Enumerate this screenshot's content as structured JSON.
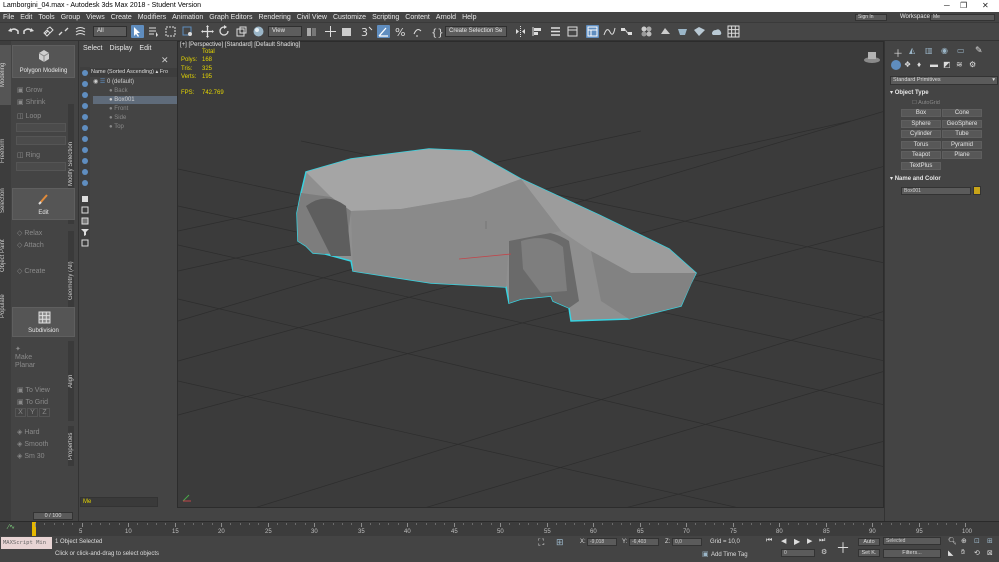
{
  "app": {
    "window_title": "Lamborgini_04.max - Autodesk 3ds Max 2018 - Student Version",
    "workspaces_label": "Workspaces:",
    "workspace_value": "Me",
    "signin_value": "Sign In"
  },
  "menu": [
    "File",
    "Edit",
    "Tools",
    "Group",
    "Views",
    "Create",
    "Modifiers",
    "Animation",
    "Graph Editors",
    "Rendering",
    "Civil View",
    "Customize",
    "Scripting",
    "Content",
    "Arnold",
    "Help"
  ],
  "toolbar": {
    "filter_value": "All",
    "refcoord_value": "View",
    "selection_set_value": "Create Selection Se"
  },
  "ribbon": {
    "tabs": [
      "Modeling",
      "Freeform",
      "Selection",
      "Object Paint",
      "Populate"
    ],
    "polygon_modeling": "Polygon Modeling",
    "grow": "Grow",
    "shrink": "Shrink",
    "loop": "Loop",
    "ring": "Ring",
    "edit": "Edit",
    "relax": "Relax",
    "attach": "Attach",
    "create": "Create",
    "modify_selection": "Modify Selection",
    "geometry_all": "Geometry (All)",
    "subdivision": "Subdivision",
    "make_planar": "Make Planar",
    "to_view": "To View",
    "to_grid": "To Grid",
    "xyz": [
      "X",
      "Y",
      "Z"
    ],
    "align": "Align",
    "hard": "Hard",
    "smooth": "Smooth",
    "smooth_30": "Sm 30",
    "properties": "Properties"
  },
  "scene_explorer": {
    "tabs": [
      "Select",
      "Display",
      "Edit"
    ],
    "column_header": "Name (Sorted Ascending)",
    "column_header2": "▴ Fro",
    "rows": [
      {
        "name": "0 (default)",
        "level": 0
      },
      {
        "name": "Back",
        "level": 1
      },
      {
        "name": "Box001",
        "level": 1
      },
      {
        "name": "Front",
        "level": 1
      },
      {
        "name": "Side",
        "level": 1
      },
      {
        "name": "Top",
        "level": 1
      }
    ],
    "layer_label": "Me"
  },
  "viewport": {
    "label": "[+] [Perspective] [Standard] [Default Shading]",
    "stats": {
      "total_label": "Total",
      "polys_label": "Polys:",
      "polys": "168",
      "tris_label": "Tris:",
      "tris": "325",
      "verts_label": "Verts:",
      "verts": "195",
      "fps_label": "FPS:",
      "fps": "742.769"
    }
  },
  "command_panel": {
    "category_value": "Standard Primitives",
    "object_type_header": "Object Type",
    "autogrid": "AutoGrid",
    "buttons": [
      "Box",
      "Cone",
      "Sphere",
      "GeoSphere",
      "Cylinder",
      "Tube",
      "Torus",
      "Pyramid",
      "Teapot",
      "Plane",
      "TextPlus"
    ],
    "name_color_header": "Name and Color",
    "object_name": "Box001",
    "object_color": "#c8a418"
  },
  "timeline": {
    "frame_counter": "0 / 100",
    "ticks": [
      "0",
      "5",
      "10",
      "15",
      "20",
      "25",
      "30",
      "35",
      "40",
      "45",
      "50",
      "55",
      "60",
      "65",
      "70",
      "75",
      "80",
      "85",
      "90",
      "95",
      "100"
    ]
  },
  "status": {
    "maxscript_placeholder": "MAXScript Min",
    "objects_selected": "1 Object Selected",
    "prompt": "Click or click-and-drag to select objects",
    "x_label": "X:",
    "x_value": "-9,018",
    "y_label": "Y:",
    "y_value": "-6,403",
    "z_label": "Z:",
    "z_value": "0,0",
    "grid_label": "Grid = 10,0",
    "add_time_tag": "Add Time Tag",
    "current_frame": "0",
    "auto": "Auto",
    "set_key": "Set K.",
    "key_mode_value": "Selected",
    "filters": "Filters..."
  },
  "colors": {
    "accent_blue": "#5f8dbf",
    "selection_outline": "#38d2e0",
    "stats_yellow": "#e6d700",
    "viewport_bg": "#3b3b3b"
  }
}
